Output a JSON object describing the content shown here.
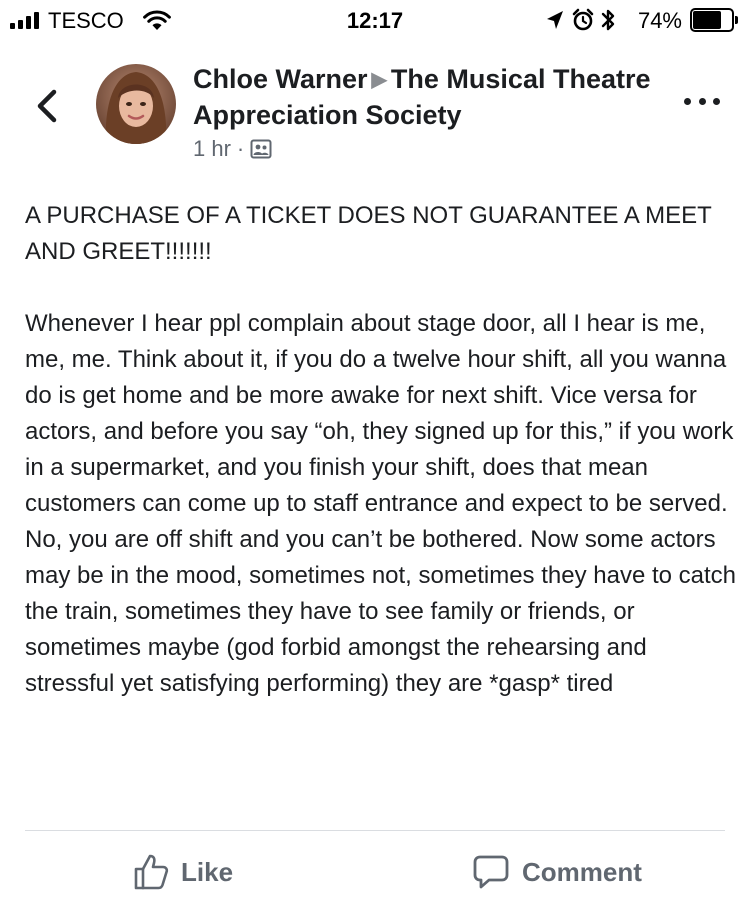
{
  "status_bar": {
    "carrier": "TESCO",
    "time": "12:17",
    "battery_percent": "74%",
    "battery_level": 0.74,
    "icons": [
      "signal-icon",
      "wifi-icon",
      "location-icon",
      "alarm-icon",
      "bluetooth-icon",
      "battery-icon"
    ]
  },
  "header": {
    "author": "Chloe Warner",
    "group": "The Musical Theatre Appreciation Society",
    "timestamp": "1 hr",
    "separator": "·",
    "icons": [
      "back-icon",
      "avatar",
      "audience-icon",
      "more-options-icon"
    ]
  },
  "post": {
    "headline": "A PURCHASE OF A TICKET DOES NOT GUARANTEE A MEET AND GREET!!!!!!!",
    "body": "Whenever I hear ppl complain about stage door, all I hear is me, me, me. Think about it, if you do a twelve hour shift, all you wanna do is get home and be more awake for next shift. Vice versa for actors, and before you say “oh, they signed up for this,” if you work in a supermarket, and you finish your shift, does that mean customers can come up to staff entrance and expect to be served. No, you are off shift and you can’t be bothered. Now some actors may be in the mood, sometimes not, sometimes they have to catch the train, sometimes they have to see family or friends, or sometimes maybe (god forbid amongst the rehearsing and stressful yet satisfying performing) they are *gasp* tired"
  },
  "actions": {
    "like_label": "Like",
    "comment_label": "Comment",
    "icons": [
      "like-icon",
      "comment-icon"
    ]
  },
  "colors": {
    "text": "#1c1e21",
    "secondary": "#606770",
    "divider": "#dadde1"
  }
}
